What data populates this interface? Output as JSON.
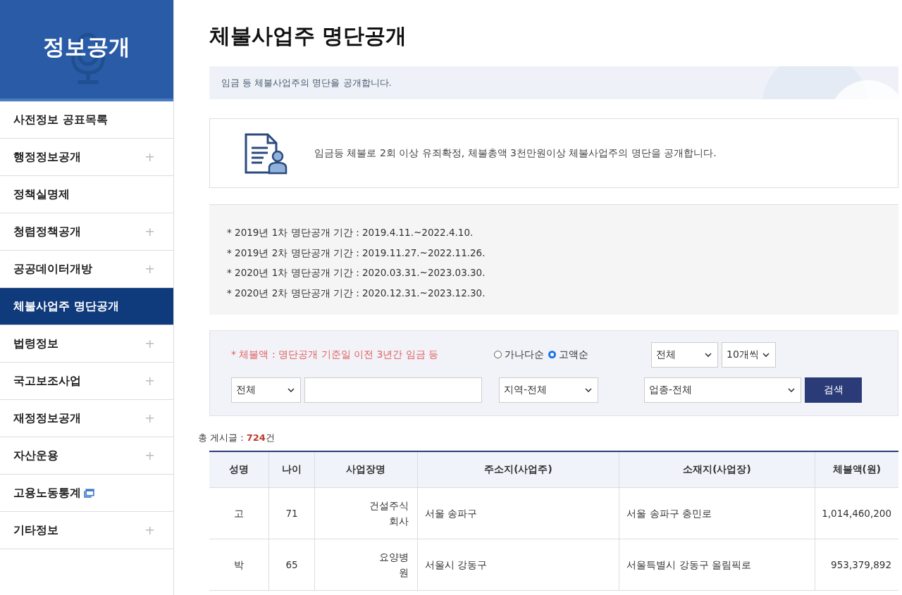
{
  "sidebar": {
    "title": "정보공개",
    "items": [
      {
        "label": "사전정보 공표목록",
        "kind": "plain",
        "selected": false
      },
      {
        "label": "행정정보공개",
        "kind": "expand",
        "selected": false
      },
      {
        "label": "정책실명제",
        "kind": "plain",
        "selected": false
      },
      {
        "label": "청렴정책공개",
        "kind": "expand",
        "selected": false
      },
      {
        "label": "공공데이터개방",
        "kind": "expand",
        "selected": false
      },
      {
        "label": "체불사업주 명단공개",
        "kind": "plain",
        "selected": true
      },
      {
        "label": "법령정보",
        "kind": "expand",
        "selected": false
      },
      {
        "label": "국고보조사업",
        "kind": "expand",
        "selected": false
      },
      {
        "label": "재정정보공개",
        "kind": "expand",
        "selected": false
      },
      {
        "label": "자산운용",
        "kind": "expand",
        "selected": false
      },
      {
        "label": "고용노동통계",
        "kind": "external",
        "selected": false
      },
      {
        "label": "기타정보",
        "kind": "expand",
        "selected": false
      }
    ]
  },
  "page": {
    "title": "체불사업주 명단공개",
    "subtitle": "임금 등 체불사업주의 명단을 공개합니다."
  },
  "info": {
    "text": "임금등 체불로 2회 이상 유죄확정, 체불총액 3천만원이상 체불사업주의 명단을 공개합니다."
  },
  "periods": [
    "* 2019년 1차 명단공개 기간 : 2019.4.11.~2022.4.10.",
    "* 2019년 2차 명단공개 기간 : 2019.11.27.~2022.11.26.",
    "* 2020년 1차 명단공개 기간 : 2020.03.31.~2023.03.30.",
    "* 2020년 2차 명단공개 기간 : 2020.12.31.~2023.12.30."
  ],
  "search": {
    "note": "* 체불액 : 명단공개 기준일 이전 3년간 임금 등",
    "sort_options": [
      {
        "label": "가나다순",
        "selected": false
      },
      {
        "label": "고액순",
        "selected": true
      }
    ],
    "year_select": "전체",
    "page_size_select": "10개씩",
    "field_select": "전체",
    "region_select": "지역-전체",
    "industry_select": "업종-전체",
    "button": "검색"
  },
  "total": {
    "label": "총 게시글 : ",
    "count": "724",
    "unit": "건"
  },
  "table": {
    "columns": [
      "성명",
      "나이",
      "사업장명",
      "주소지(사업주)",
      "소재지(사업장)",
      "체불액(원)"
    ],
    "rows": [
      {
        "name": "고",
        "age": "71",
        "business": [
          "건설주식",
          "회사"
        ],
        "owner_address": "서울 송파구",
        "site_address": "서울 송파구 충민로",
        "amount": "1,014,460,200"
      },
      {
        "name": "박",
        "age": "65",
        "business": [
          "요양병",
          "원"
        ],
        "owner_address": "서울시 강동구",
        "site_address": "서울특별시 강동구 올림픽로",
        "amount": "953,379,892"
      }
    ]
  }
}
